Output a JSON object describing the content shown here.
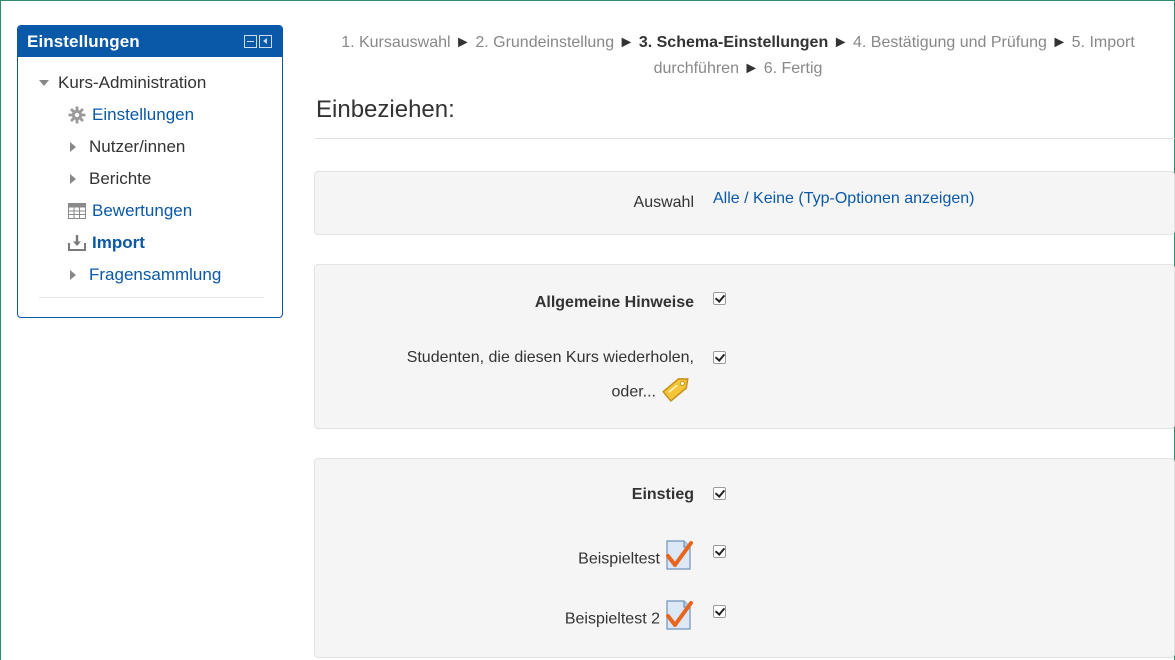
{
  "block": {
    "title": "Einstellungen",
    "tree": {
      "root_label": "Kurs-Administration",
      "items": [
        {
          "label": "Einstellungen",
          "icon": "gear-icon",
          "type": "link"
        },
        {
          "label": "Nutzer/innen",
          "icon": "caret-right-icon",
          "type": "collapsed"
        },
        {
          "label": "Berichte",
          "icon": "caret-right-icon",
          "type": "collapsed"
        },
        {
          "label": "Bewertungen",
          "icon": "gradebook-icon",
          "type": "link"
        },
        {
          "label": "Import",
          "icon": "import-icon",
          "type": "active"
        },
        {
          "label": "Fragensammlung",
          "icon": "caret-right-icon",
          "type": "collapsed"
        }
      ]
    }
  },
  "steps": {
    "s1": "1. Kursauswahl",
    "s2": "2. Grundeinstellung",
    "s3": "3. Schema-Einstellungen",
    "s4": "4. Bestätigung und Prüfung",
    "s5": "5. Import durchführen",
    "s6": "6. Fertig",
    "separator": "►"
  },
  "section_title": "Einbeziehen:",
  "selection": {
    "label": "Auswahl",
    "all": "Alle",
    "slash": " / ",
    "none": "Keine",
    "type_options": "(Typ-Optionen anzeigen)"
  },
  "section1": {
    "header": "Allgemeine Hinweise",
    "header_checked": true,
    "item_label_line1": "Studenten, die diesen Kurs wiederholen,",
    "item_label_line2": "oder...",
    "item_icon": "label-tag-icon",
    "item_checked": true
  },
  "section2": {
    "header": "Einstieg",
    "header_checked": true,
    "items": [
      {
        "label": "Beispieltest",
        "icon": "quiz-icon",
        "checked": true
      },
      {
        "label": "Beispieltest 2",
        "icon": "quiz-icon",
        "checked": true
      }
    ]
  },
  "colors": {
    "brand": "#0a58a8",
    "fieldset_bg": "#f5f5f5",
    "muted_text": "#888888"
  }
}
